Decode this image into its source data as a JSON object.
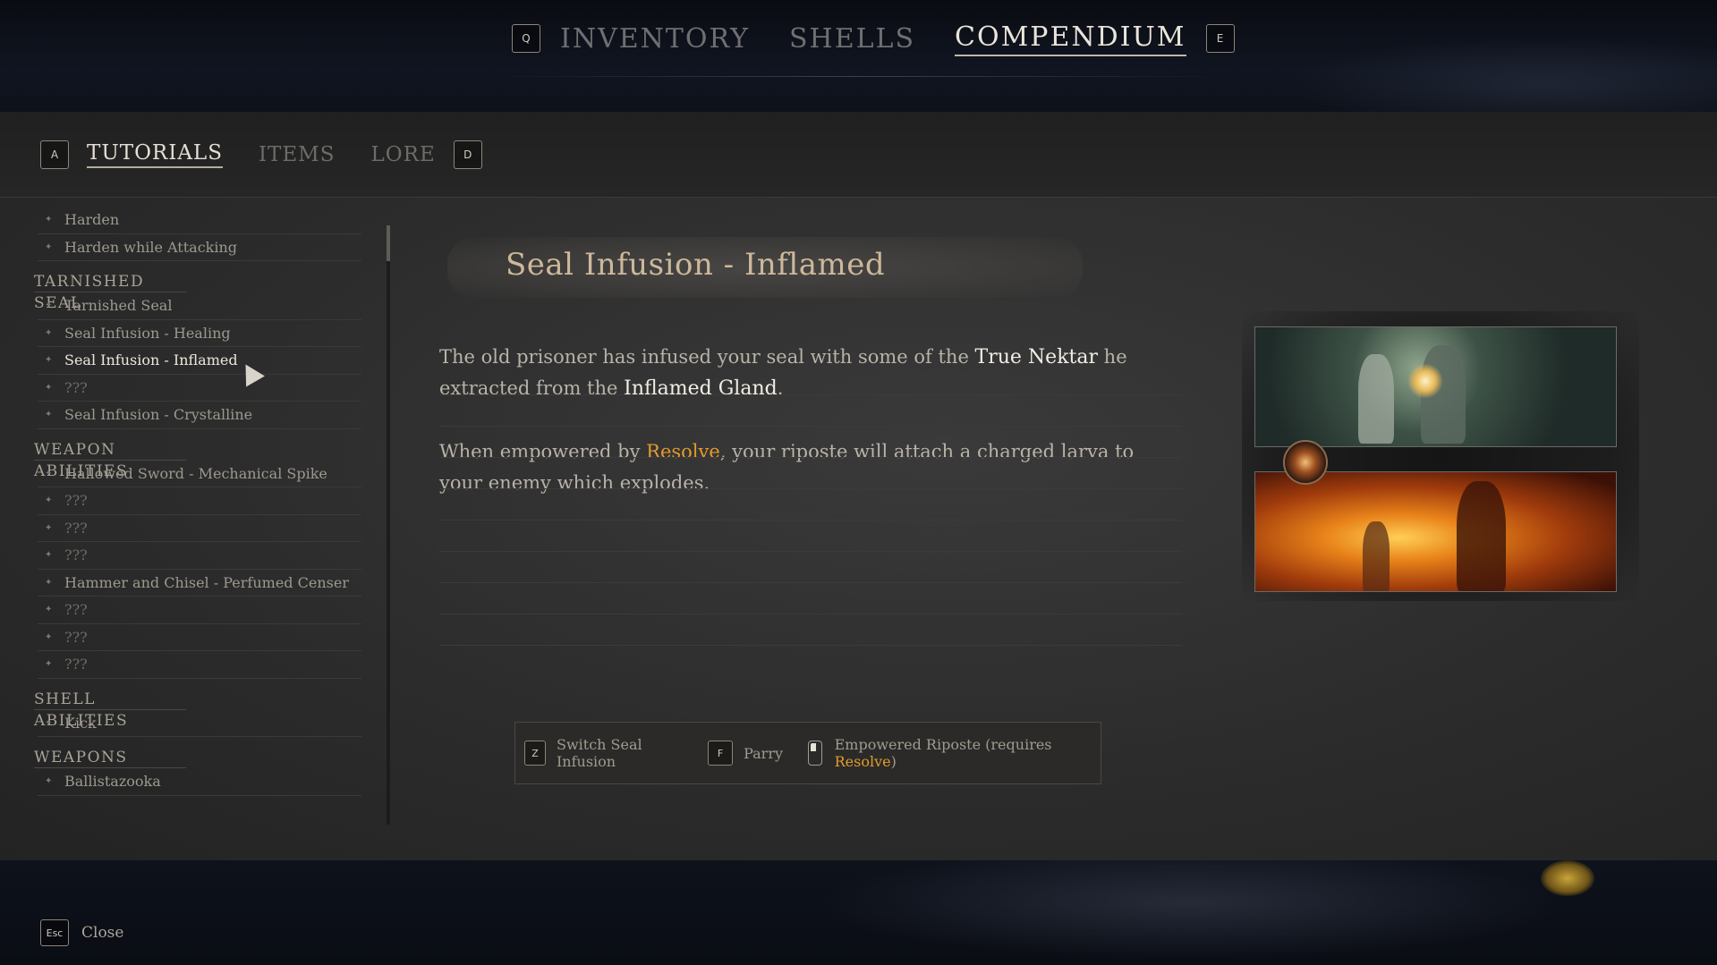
{
  "topnav": {
    "left_key": "Q",
    "right_key": "E",
    "tabs": [
      {
        "label": "INVENTORY",
        "active": false
      },
      {
        "label": "SHELLS",
        "active": false
      },
      {
        "label": "COMPENDIUM",
        "active": true
      }
    ]
  },
  "subnav": {
    "left_key": "A",
    "right_key": "D",
    "tabs": [
      {
        "label": "TUTORIALS",
        "active": true
      },
      {
        "label": "ITEMS",
        "active": false
      },
      {
        "label": "LORE",
        "active": false
      }
    ]
  },
  "sidebar": {
    "entries": [
      {
        "type": "item",
        "label": "Harden"
      },
      {
        "type": "item",
        "label": "Harden while Attacking"
      },
      {
        "type": "section",
        "label": "TARNISHED SEAL"
      },
      {
        "type": "item",
        "label": "Tarnished Seal"
      },
      {
        "type": "item",
        "label": "Seal Infusion - Healing"
      },
      {
        "type": "item",
        "label": "Seal Infusion - Inflamed",
        "selected": true
      },
      {
        "type": "item",
        "label": "???",
        "unknown": true
      },
      {
        "type": "item",
        "label": "Seal Infusion - Crystalline"
      },
      {
        "type": "section",
        "label": "WEAPON ABILITIES"
      },
      {
        "type": "item",
        "label": "Hallowed Sword - Mechanical Spike"
      },
      {
        "type": "item",
        "label": "???",
        "unknown": true
      },
      {
        "type": "item",
        "label": "???",
        "unknown": true
      },
      {
        "type": "item",
        "label": "???",
        "unknown": true
      },
      {
        "type": "item",
        "label": "Hammer and Chisel - Perfumed Censer"
      },
      {
        "type": "item",
        "label": "???",
        "unknown": true
      },
      {
        "type": "item",
        "label": "???",
        "unknown": true
      },
      {
        "type": "item",
        "label": "???",
        "unknown": true
      },
      {
        "type": "section",
        "label": "SHELL ABILITIES"
      },
      {
        "type": "item",
        "label": "Kick"
      },
      {
        "type": "section",
        "label": "WEAPONS"
      },
      {
        "type": "item",
        "label": "Ballistazooka"
      }
    ]
  },
  "content": {
    "title": "Seal Infusion - Inflamed",
    "para1": {
      "t1": "The old prisoner has infused your seal with some of the ",
      "h1": "True Nektar",
      "t2": " he extracted from the ",
      "h2": "Inflamed Gland",
      "t3": "."
    },
    "para2": {
      "t1": "When empowered by ",
      "g1": "Resolve",
      "t2": ", your riposte will attach a charged larva to your enemy which explodes."
    }
  },
  "prompts": {
    "switch_key": "Z",
    "switch_label": "Switch Seal Infusion",
    "parry_key": "F",
    "parry_label": "Parry",
    "riposte_label": "Empowered Riposte (requires ",
    "riposte_gold": "Resolve",
    "riposte_end": ")"
  },
  "footer": {
    "close_key": "Esc",
    "close_label": "Close"
  },
  "colors": {
    "accent_gold": "#e19b2c",
    "title": "#cdb89b"
  }
}
